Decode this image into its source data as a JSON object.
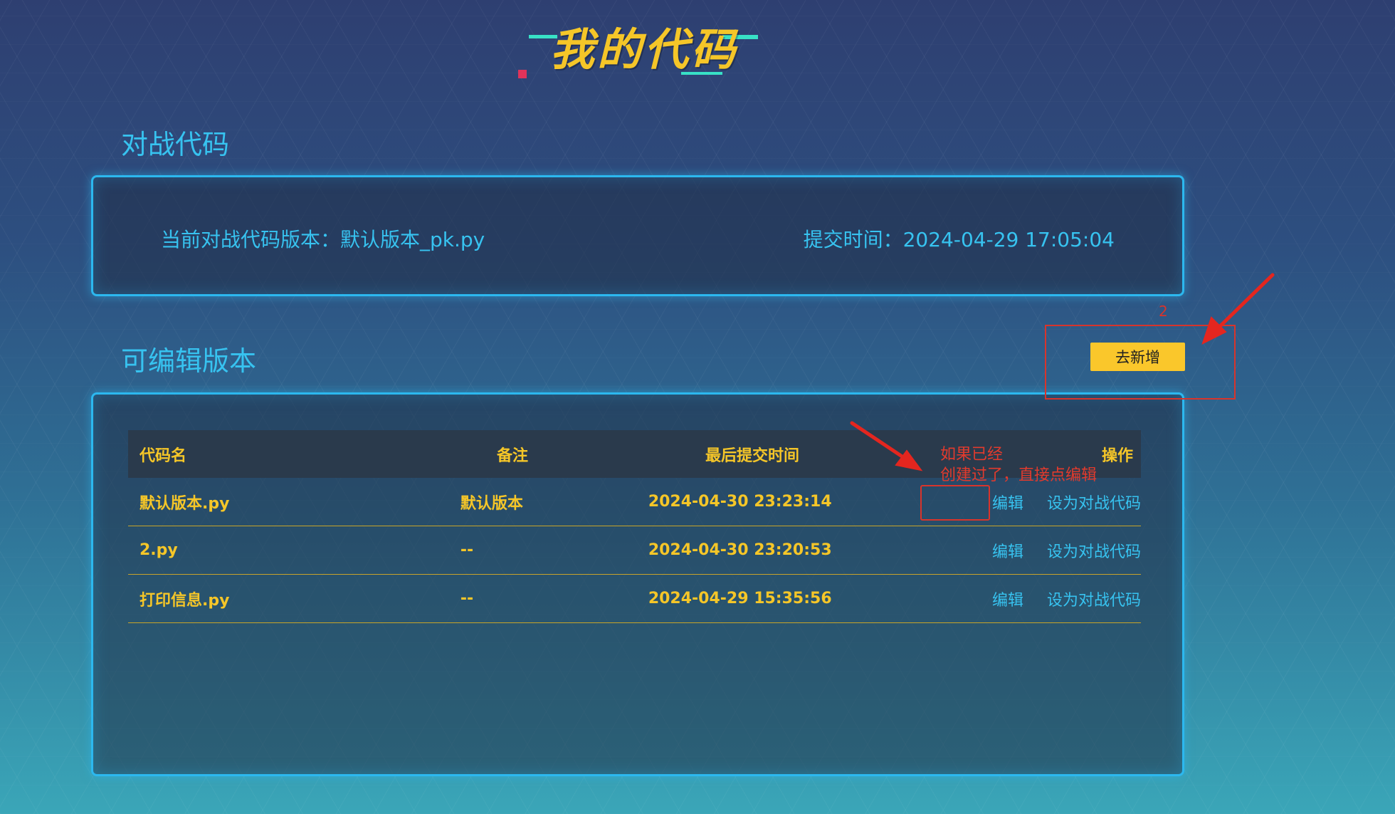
{
  "page": {
    "title": "我的代码"
  },
  "battle_section": {
    "heading": "对战代码",
    "current_version_label": "当前对战代码版本：默认版本_pk.py",
    "submit_time_label": "提交时间：2024-04-29 17:05:04"
  },
  "versions_section": {
    "heading": "可编辑版本",
    "add_button_label": "去新增",
    "table": {
      "columns": [
        "代码名",
        "备注",
        "最后提交时间",
        "操作"
      ],
      "rows": [
        {
          "name": "默认版本.py",
          "note": "默认版本",
          "time": "2024-04-30 23:23:14",
          "edit": "编辑",
          "set_battle": "设为对战代码"
        },
        {
          "name": "2.py",
          "note": "--",
          "time": "2024-04-30 23:20:53",
          "edit": "编辑",
          "set_battle": "设为对战代码"
        },
        {
          "name": "打印信息.py",
          "note": "--",
          "time": "2024-04-29 15:35:56",
          "edit": "编辑",
          "set_battle": "设为对战代码"
        }
      ]
    }
  },
  "annotations": {
    "number_label": "2",
    "edit_hint_line1": "如果已经",
    "edit_hint_line2": "创建过了，直接点编辑",
    "annotation_color": "#d9342b"
  },
  "colors": {
    "accent_blue": "#37c3f0",
    "accent_yellow": "#f5c628",
    "button_yellow": "#fac72b",
    "panel_border": "#2cb8ef"
  }
}
